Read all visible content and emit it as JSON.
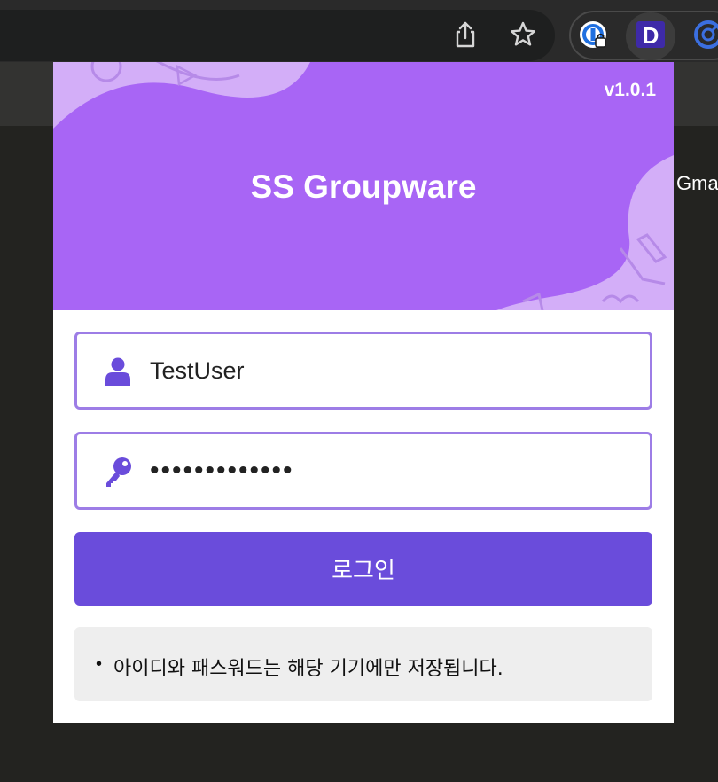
{
  "browser": {
    "share_icon": "share-icon",
    "bookmark_icon": "star-icon",
    "extensions": [
      "password-manager-icon",
      "d-extension-icon",
      "blue-extension-icon"
    ],
    "ext_d_letter": "D"
  },
  "background_page": {
    "partial_text": "Gma"
  },
  "popup": {
    "version": "v1.0.1",
    "title": "SS Groupware",
    "username": {
      "icon": "user-icon",
      "value": "TestUser"
    },
    "password": {
      "icon": "key-icon",
      "masked_value": "•••••••••••••"
    },
    "login_label": "로그인",
    "notice_bullet": "•",
    "notice_text": "아이디와 패스워드는 해당 기기에만 저장됩니다.",
    "colors": {
      "banner": "#a865f5",
      "accent": "#6a4cdb",
      "field_border": "#9d7de6",
      "notice_bg": "#eeeeee"
    }
  }
}
